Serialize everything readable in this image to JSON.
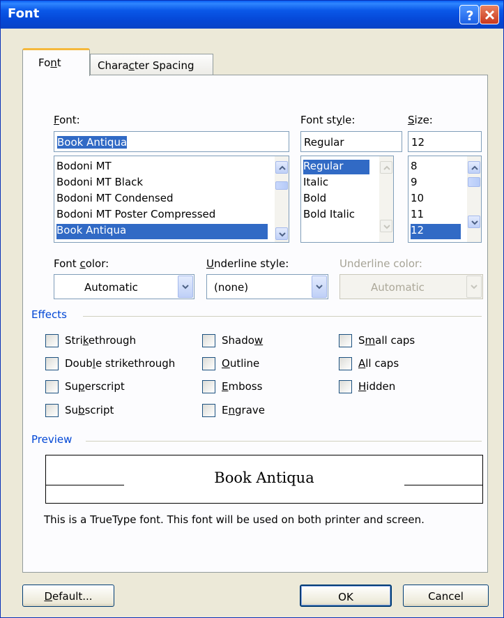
{
  "window": {
    "title": "Font"
  },
  "title_buttons": {
    "help_glyph": "?",
    "close_glyph": "X"
  },
  "tabs": [
    {
      "label_pre": "Fo",
      "label_u": "n",
      "label_post": "t",
      "selected": true
    },
    {
      "label_pre": "Chara",
      "label_u": "c",
      "label_post": "ter Spacing",
      "selected": false
    }
  ],
  "font_section": {
    "font_label_u": "F",
    "font_label_post": "ont:",
    "font_value": "Book Antiqua",
    "font_list": [
      "Bodoni MT",
      "Bodoni MT Black",
      "Bodoni MT Condensed",
      "Bodoni MT Poster Compressed",
      "Book Antiqua"
    ],
    "font_selected": "Book Antiqua",
    "style_label_pre": "Font st",
    "style_label_u": "y",
    "style_label_post": "le:",
    "style_value": "Regular",
    "style_list": [
      "Regular",
      "Italic",
      "Bold",
      "Bold Italic"
    ],
    "style_selected": "Regular",
    "size_label_u": "S",
    "size_label_post": "ize:",
    "size_value": "12",
    "size_list": [
      "8",
      "9",
      "10",
      "11",
      "12"
    ],
    "size_selected": "12"
  },
  "dropdowns": {
    "font_color": {
      "label_pre": "Font ",
      "label_u": "c",
      "label_post": "olor:",
      "value": "Automatic"
    },
    "underline_style": {
      "label_u": "U",
      "label_post": "nderline style:",
      "value": "(none)"
    },
    "underline_color": {
      "label": "Underline color:",
      "value": "Automatic",
      "enabled": false
    }
  },
  "effects": {
    "title": "Effects",
    "checkboxes": [
      {
        "pre": "Stri",
        "u": "k",
        "post": "ethrough",
        "checked": false
      },
      {
        "pre": "Doub",
        "u": "l",
        "post": "e strikethrough",
        "checked": false
      },
      {
        "pre": "Su",
        "u": "p",
        "post": "erscript",
        "checked": false
      },
      {
        "pre": "Su",
        "u": "b",
        "post": "script",
        "checked": false
      },
      {
        "pre": "Shado",
        "u": "w",
        "post": "",
        "checked": false
      },
      {
        "pre": "",
        "u": "O",
        "post": "utline",
        "checked": false
      },
      {
        "pre": "",
        "u": "E",
        "post": "mboss",
        "checked": false
      },
      {
        "pre": "E",
        "u": "n",
        "post": "grave",
        "checked": false
      },
      {
        "pre": "S",
        "u": "m",
        "post": "all caps",
        "checked": false
      },
      {
        "pre": "",
        "u": "A",
        "post": "ll caps",
        "checked": false
      },
      {
        "pre": "",
        "u": "H",
        "post": "idden",
        "checked": false
      }
    ]
  },
  "preview": {
    "title": "Preview",
    "sample_text": "Book Antiqua",
    "note": "This is a TrueType font. This font will be used on both printer and screen."
  },
  "buttons": {
    "default_pre": "",
    "default_u": "D",
    "default_post": "efault...",
    "ok": "OK",
    "cancel": "Cancel"
  },
  "colors": {
    "title_bar": "#0a58e8",
    "selection": "#316ac5",
    "group_title": "#0046d5",
    "tab_highlight": "#f5b83c",
    "dialog_bg": "#ece9d8"
  }
}
